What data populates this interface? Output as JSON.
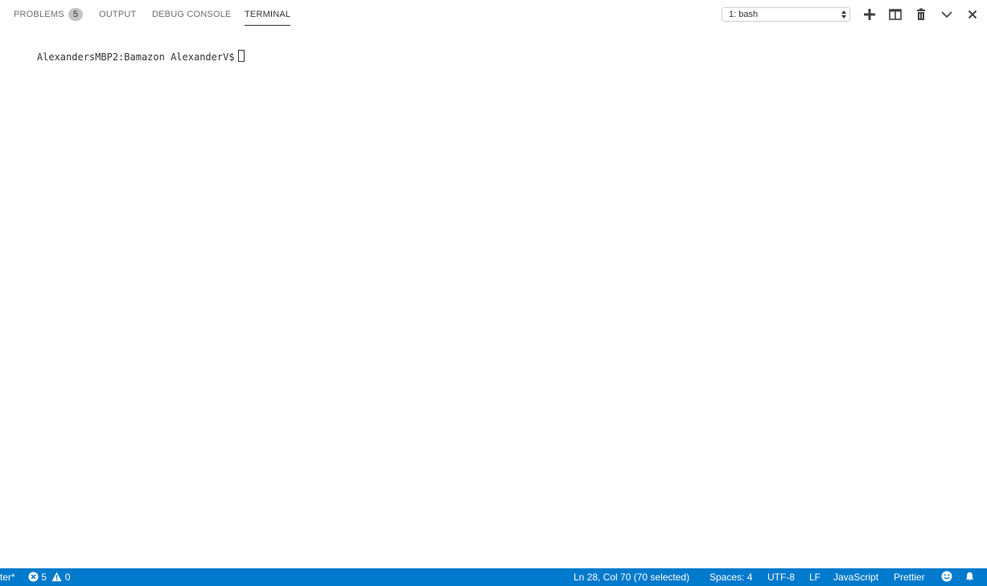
{
  "panel": {
    "tabs": [
      {
        "label": "PROBLEMS",
        "badge": "5",
        "active": false
      },
      {
        "label": "OUTPUT",
        "active": false
      },
      {
        "label": "DEBUG CONSOLE",
        "active": false
      },
      {
        "label": "TERMINAL",
        "active": true
      }
    ],
    "terminal_select": {
      "value": "1: bash"
    },
    "actions": [
      "plus-icon",
      "split-icon",
      "trash-icon",
      "chevron-down-icon",
      "close-icon"
    ]
  },
  "terminal": {
    "prompt": "AlexandersMBP2:Bamazon AlexanderV$"
  },
  "statusbar": {
    "branch_fragment": "ter*",
    "errors": "5",
    "warnings": "0",
    "cursor_position": "Ln 28, Col 70 (70 selected)",
    "indentation": "Spaces: 4",
    "encoding": "UTF-8",
    "eol": "LF",
    "language": "JavaScript",
    "formatter": "Prettier",
    "icons": [
      "error-icon",
      "warning-icon",
      "smiley-icon",
      "bell-icon"
    ],
    "color": "#007acc"
  }
}
